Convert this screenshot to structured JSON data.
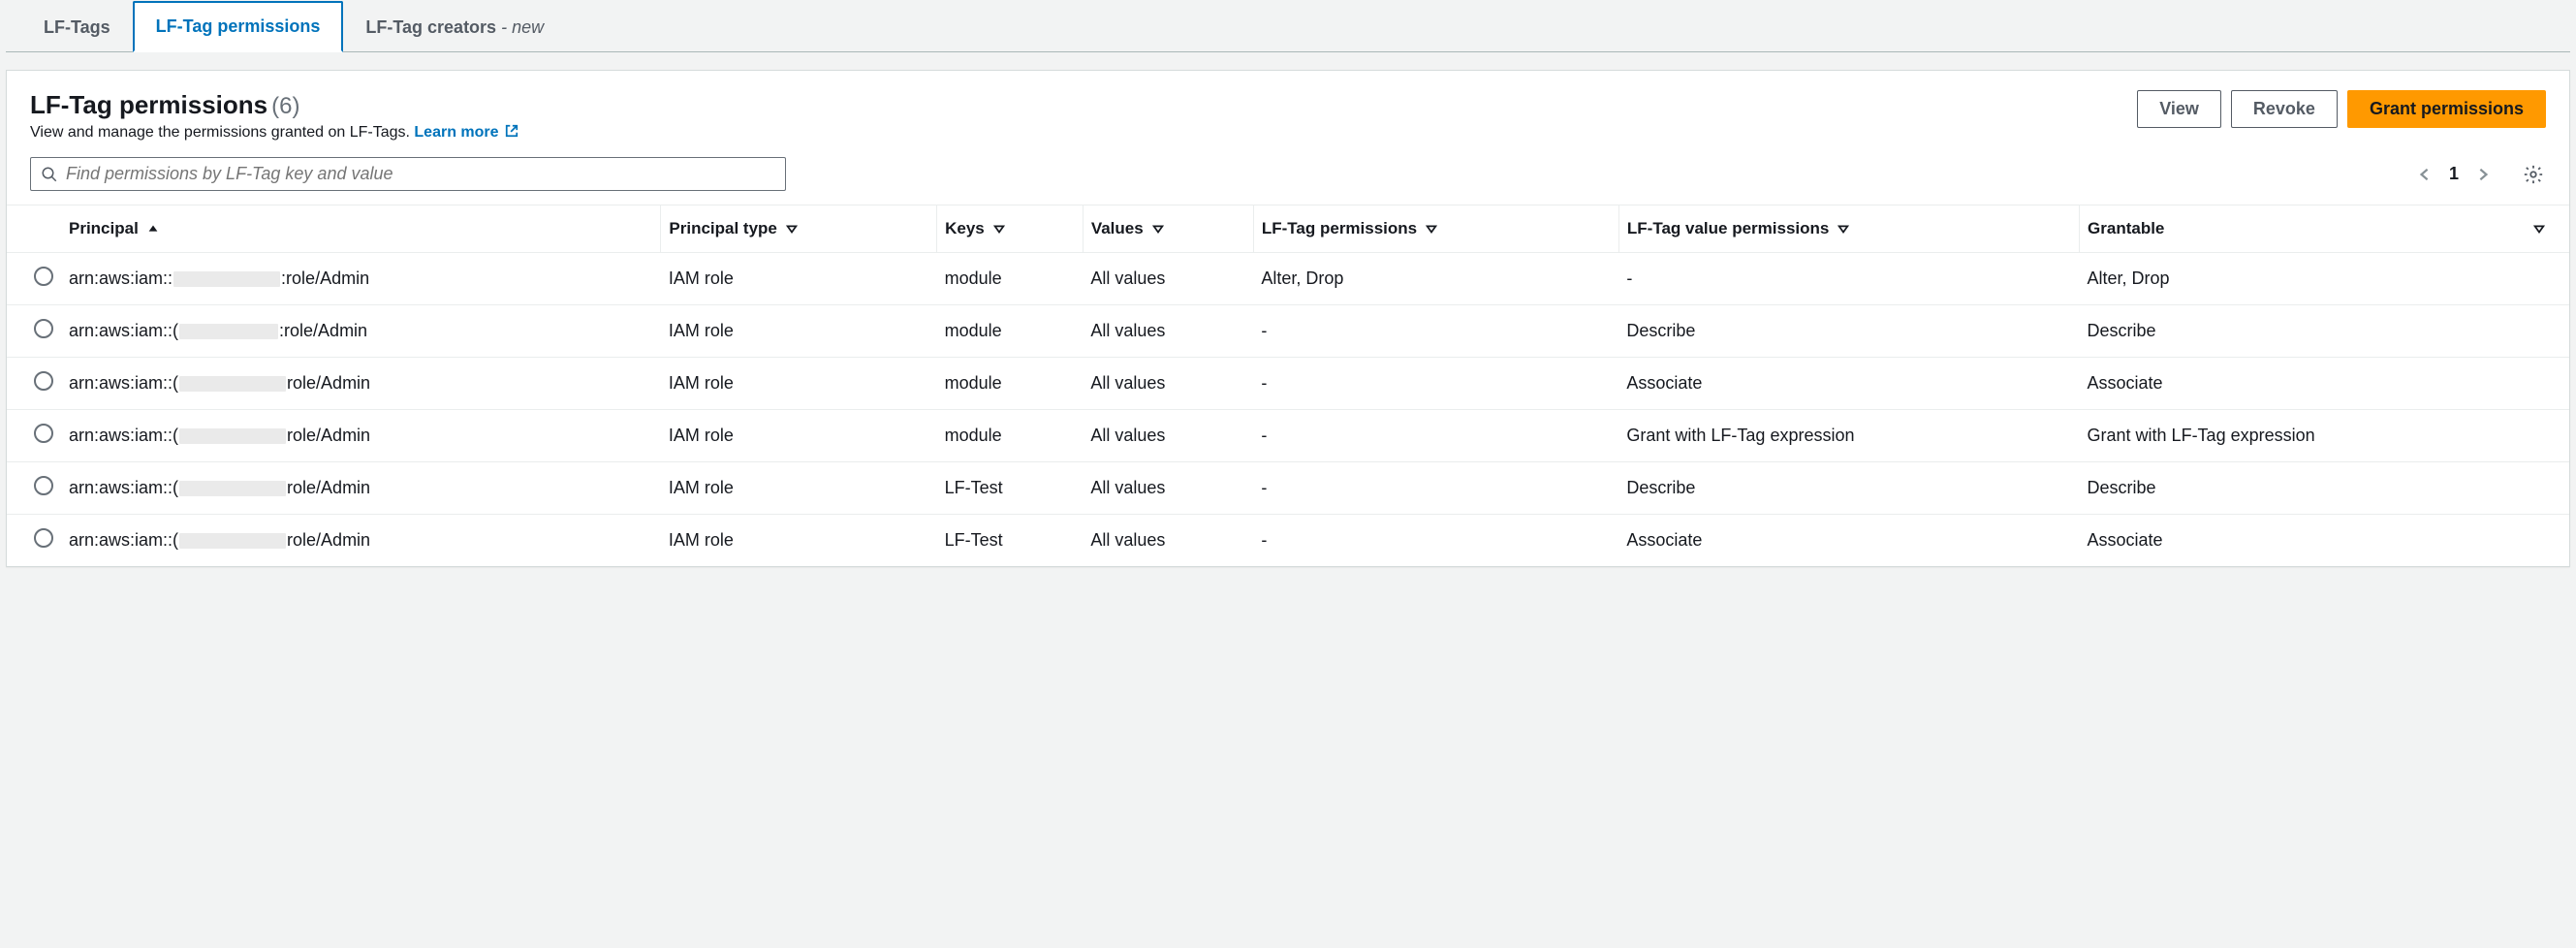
{
  "tabs": {
    "lf_tags": "LF-Tags",
    "lf_tag_permissions": "LF-Tag permissions",
    "lf_tag_creators": "LF-Tag creators",
    "new_suffix": " - new"
  },
  "header": {
    "title": "LF-Tag permissions",
    "count": "(6)",
    "subtitle": "View and manage the permissions granted on LF-Tags.",
    "learn_more": "Learn more"
  },
  "buttons": {
    "view": "View",
    "revoke": "Revoke",
    "grant": "Grant permissions"
  },
  "search": {
    "placeholder": "Find permissions by LF-Tag key and value"
  },
  "pagination": {
    "page": "1"
  },
  "columns": {
    "principal": "Principal",
    "principal_type": "Principal type",
    "keys": "Keys",
    "values": "Values",
    "lf_tag_permissions": "LF-Tag permissions",
    "lf_tag_value_permissions": "LF-Tag value permissions",
    "grantable": "Grantable"
  },
  "rows": [
    {
      "principal_prefix": "arn:aws:iam::",
      "principal_suffix": ":role/Admin",
      "redact_w": 110,
      "principal_type": "IAM role",
      "keys": "module",
      "values": "All values",
      "perm": "Alter, Drop",
      "val_perm": "-",
      "grantable": "Alter, Drop"
    },
    {
      "principal_prefix": "arn:aws:iam::(",
      "principal_suffix": ":role/Admin",
      "redact_w": 102,
      "principal_type": "IAM role",
      "keys": "module",
      "values": "All values",
      "perm": "-",
      "val_perm": "Describe",
      "grantable": "Describe"
    },
    {
      "principal_prefix": "arn:aws:iam::(",
      "principal_suffix": "role/Admin",
      "redact_w": 110,
      "principal_type": "IAM role",
      "keys": "module",
      "values": "All values",
      "perm": "-",
      "val_perm": "Associate",
      "grantable": "Associate"
    },
    {
      "principal_prefix": "arn:aws:iam::(",
      "principal_suffix": "role/Admin",
      "redact_w": 110,
      "principal_type": "IAM role",
      "keys": "module",
      "values": "All values",
      "perm": "-",
      "val_perm": "Grant with LF-Tag expression",
      "grantable": "Grant with LF-Tag expression"
    },
    {
      "principal_prefix": "arn:aws:iam::(",
      "principal_suffix": "role/Admin",
      "redact_w": 110,
      "principal_type": "IAM role",
      "keys": "LF-Test",
      "values": "All values",
      "perm": "-",
      "val_perm": "Describe",
      "grantable": "Describe"
    },
    {
      "principal_prefix": "arn:aws:iam::(",
      "principal_suffix": "role/Admin",
      "redact_w": 110,
      "principal_type": "IAM role",
      "keys": "LF-Test",
      "values": "All values",
      "perm": "-",
      "val_perm": "Associate",
      "grantable": "Associate"
    }
  ]
}
